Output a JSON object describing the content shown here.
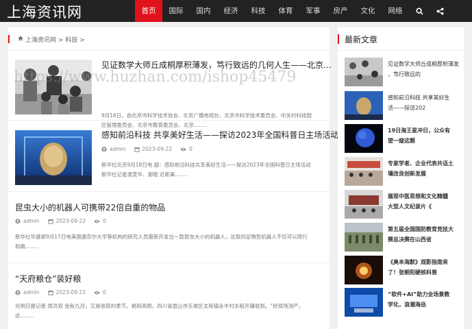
{
  "site": {
    "logo": "上海资讯网"
  },
  "nav": {
    "items": [
      "首页",
      "国际",
      "国内",
      "经济",
      "科技",
      "体育",
      "军事",
      "房产",
      "文化",
      "网络"
    ],
    "active_index": 0,
    "search_icon": "search-icon",
    "share_icon": "share-icon"
  },
  "breadcrumb": {
    "home": "上海资讯网",
    "sep1": ">",
    "current": "科技",
    "sep2": ">"
  },
  "posts": [
    {
      "title": "见证数学大师丘成桐厚积薄发，笃行致远的几何人生——北京...",
      "excerpt_line1": "9月16日，由北京市科学技术协会、北京广播电视台，北京市科学技术委员会、中关村科技园",
      "excerpt_line2": "区管理委员会、北京市教育委员会、北京........"
    },
    {
      "title": "感知前沿科技 共享美好生活——探访2023年全国科普日主场活动",
      "author": "admin",
      "date": "2023-09-22",
      "views": "0",
      "excerpt_line1": "新华社北京9月18日电 题：感知前沿科技共享美好生活——探访2023年全国科普日主场活动",
      "excerpt_line2": "新华社记者温竞华、谢暗 近距离........"
    },
    {
      "title": "昆虫大小的机器人可携带22倍自重的物品",
      "author": "admin",
      "date": "2023-09-22",
      "views": "0",
      "excerpt_line1": "新华社华盛顿9月17日电美国康奈尔大学等机构的研究人员最新开发出一款昆虫大小的机器人，这款四足微型机器人不仅可以爬行",
      "excerpt_line2": "和跳........"
    },
    {
      "title": "“天府粮仓”装好粮",
      "author": "admin",
      "date": "2023-09-22",
      "views": "0",
      "excerpt_line1": "光明日报记者 周洪双 金秋九月，又是收获的季节。艳阳高照，四川省眉山市东坡区太和镇永丰村水稻开镰收割。“经现场测产，",
      "excerpt_line2": "这........"
    }
  ],
  "sidebar": {
    "title": "最新文章",
    "items": [
      {
        "line1": "见证数学大师丘成桐厚积薄发",
        "line2": "，笃行致远的"
      },
      {
        "line1": "感知前沿科技 共享美好生",
        "line2": "活——探访202"
      },
      {
        "line1": "19日海王星冲日，公众有",
        "line2": "望一窥这颗"
      },
      {
        "line1": "专家学者、企业代表共话土",
        "line2": "壤改良创新发展"
      },
      {
        "line1": "展现中医思想和文化精髓",
        "line2": "大型人文纪录片《"
      },
      {
        "line1": "第五届全国国防教育竞技大",
        "line2": "赛总决赛在山西省"
      },
      {
        "line1": "《奥本海默》观影指南来",
        "line2": "了！张朝阳硬核科普"
      },
      {
        "line1": "“软件+AI”助力全场景教",
        "line2": "学化，浪潮海岳"
      }
    ]
  },
  "watermark": "https://www.huzhan.com/ishop45479",
  "colors": {
    "accent": "#e0121b",
    "topbar": "#222222"
  }
}
